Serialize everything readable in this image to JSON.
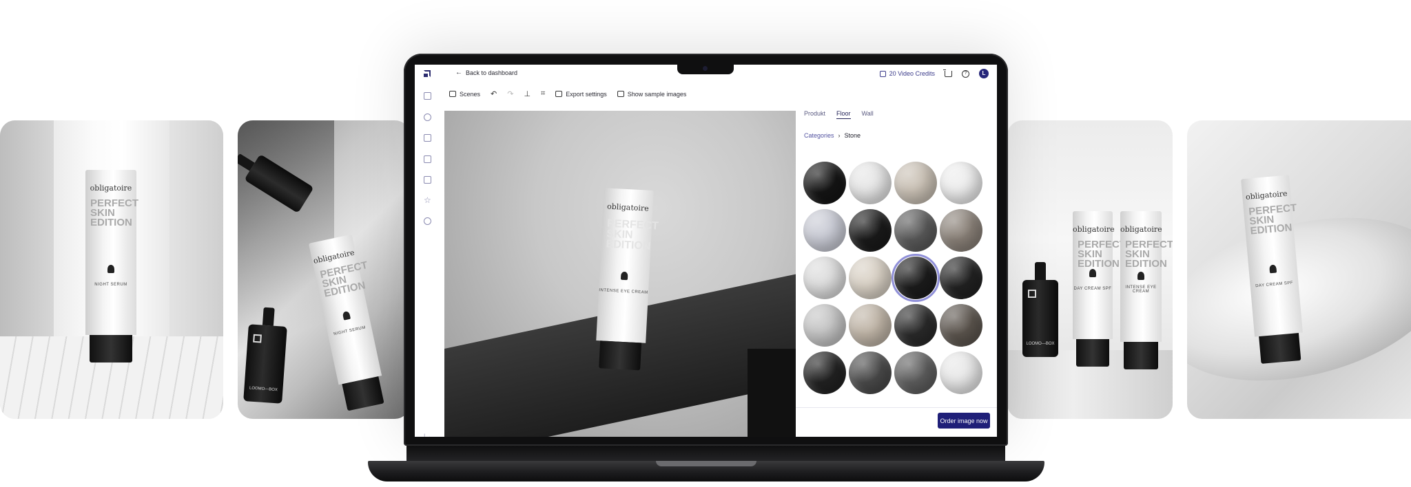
{
  "gallery": {
    "card_1": {
      "brand": "obligatoire",
      "headline": "PERFECT SKIN EDITION",
      "product": "NIGHT SERUM"
    },
    "card_2": {
      "brand": "obligatoire",
      "headline": "PERFECT SKIN EDITION",
      "product": "NIGHT SERUM",
      "bottle_text": "LOOMO—BOX"
    },
    "card_4": {
      "brand_1": "obligatoire",
      "headline_1": "PERFECT SKIN EDITION",
      "product_1": "DAY CREAM SPF",
      "brand_2": "obligatoire",
      "headline_2": "PERFECT SKIN EDITION",
      "product_2": "INTENSE EYE CREAM",
      "bottle_text": "LOOMO—BOX"
    },
    "card_5": {
      "brand": "obligatoire",
      "headline": "PERFECT SKIN EDITION",
      "product": "DAY CREAM SPF"
    }
  },
  "app": {
    "header": {
      "back_label": "Back to dashboard",
      "credits_label": "20 Video Credits",
      "avatar_initial": "L"
    },
    "toolbar": {
      "scenes_label": "Scenes",
      "export_label": "Export settings",
      "samples_label": "Show sample images"
    },
    "canvas": {
      "brand": "obligatoire",
      "headline": "PERFECT SKIN EDITION",
      "product": "INTENSE EYE CREAM"
    },
    "panel": {
      "tabs": [
        "Produkt",
        "Floor",
        "Wall"
      ],
      "active_tab": "Floor",
      "breadcrumb": {
        "parent": "Categories",
        "separator": "›",
        "current": "Stone"
      },
      "swatches": [
        "#151515",
        "#e6e6e6",
        "#c9c0b4",
        "#ededed",
        "#c8cad4",
        "#1a1a1a",
        "#5a5a5a",
        "#8a8178",
        "#dcdcdc",
        "#d8d0c4",
        "#1c1c1c",
        "#222222",
        "#c4c4c4",
        "#bfb4a6",
        "#2a2a2a",
        "#5c554e",
        "#222222",
        "#4a4a4a",
        "#5e5e5e",
        "#e8e8e8"
      ],
      "selected_swatch_index": 10,
      "order_label": "Order image now"
    }
  }
}
